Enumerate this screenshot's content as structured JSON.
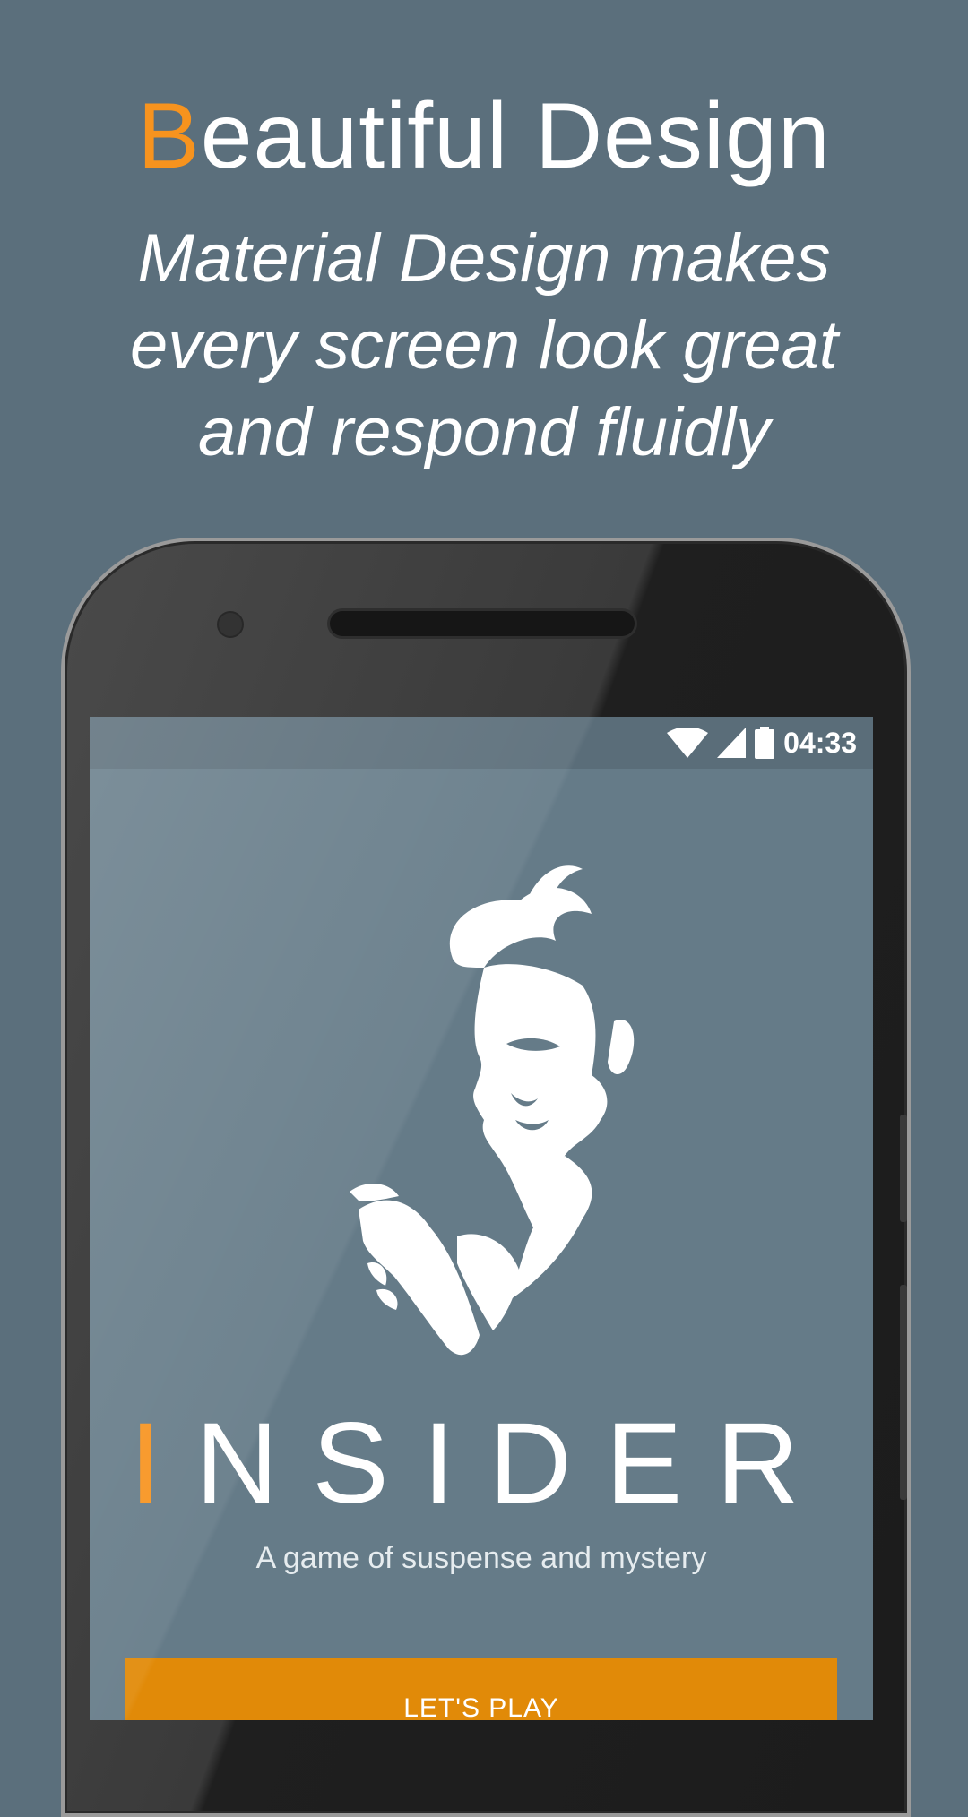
{
  "promo": {
    "headline_accent": "B",
    "headline_rest": "eautiful Design",
    "subheadline": "Material Design makes every screen look great and respond fluidly"
  },
  "status_bar": {
    "time": "04:33",
    "icons": [
      "wifi-icon",
      "cell-signal-icon",
      "battery-icon"
    ]
  },
  "app": {
    "brand_accent": "I",
    "brand_rest": "NSIDER",
    "tagline": "A game of suspense and mystery",
    "play_button": "LET'S PLAY",
    "logo_icon": "detective-portrait-logo"
  },
  "colors": {
    "background": "#5b6f7c",
    "accent": "#f7931e",
    "screen": "#657b88",
    "button": "#e18a08"
  }
}
